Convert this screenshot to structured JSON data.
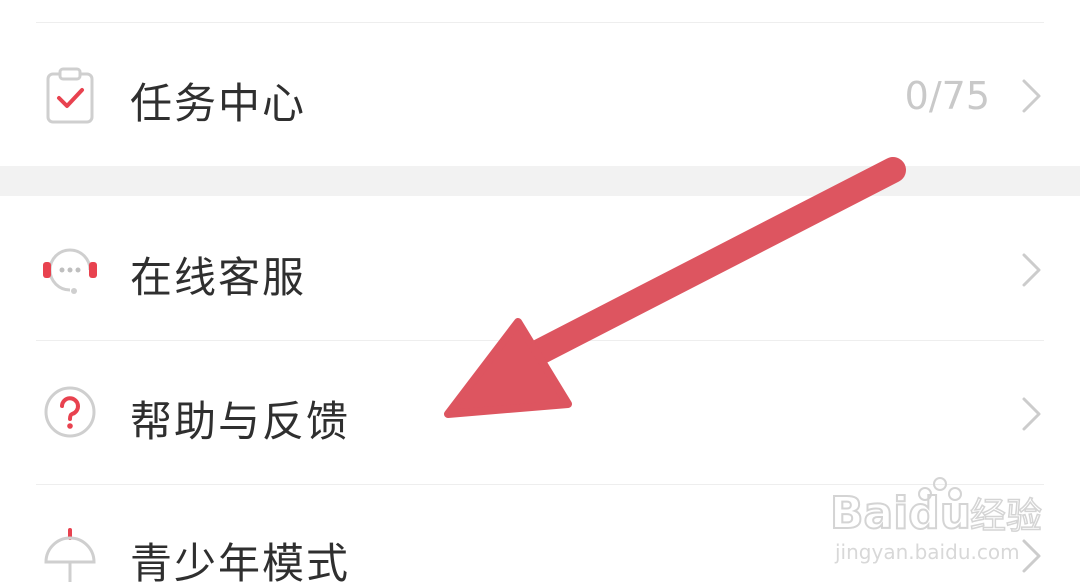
{
  "menu": {
    "items": [
      {
        "label": "任务中心",
        "value": "0/75",
        "icon": "clipboard-check-icon"
      },
      {
        "label": "在线客服",
        "value": "",
        "icon": "headset-icon"
      },
      {
        "label": "帮助与反馈",
        "value": "",
        "icon": "question-circle-icon"
      },
      {
        "label": "青少年模式",
        "value": "",
        "icon": "umbrella-icon"
      }
    ]
  },
  "watermark": {
    "brand": "Baidu",
    "cn": "经验",
    "url": "jingyan.baidu.com"
  },
  "colors": {
    "accent": "#e8424f",
    "arrow": "#dd5560",
    "text": "#2f2f2f",
    "muted": "#c9c9c9"
  }
}
